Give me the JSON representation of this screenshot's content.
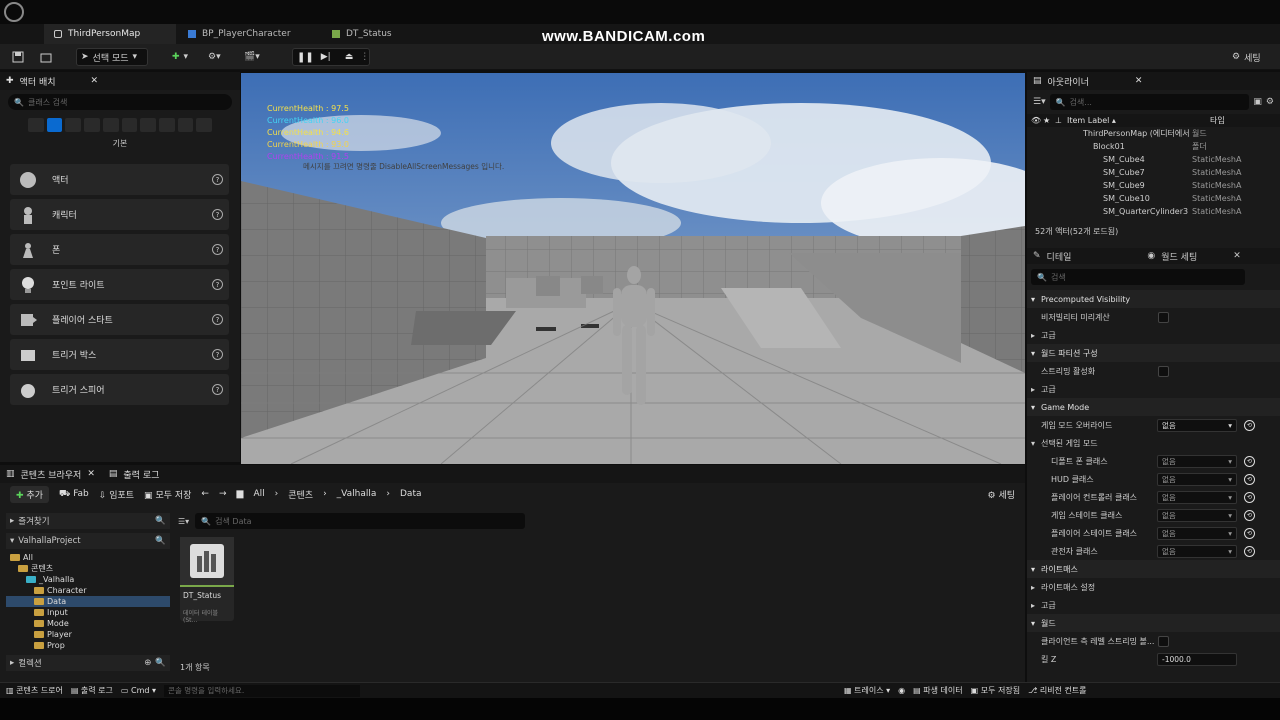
{
  "watermark": "www.BANDICAM.com",
  "tabs": [
    {
      "label": "ThirdPersonMap"
    },
    {
      "label": "BP_PlayerCharacter"
    },
    {
      "label": "DT_Status"
    }
  ],
  "toolbar": {
    "mode": "선택 모드",
    "settings": "세팅"
  },
  "place_actors": {
    "title": "액터 배치",
    "search_placeholder": "클래스 검색",
    "category": "기본",
    "items": [
      {
        "label": "액터"
      },
      {
        "label": "캐릭터"
      },
      {
        "label": "폰"
      },
      {
        "label": "포인트 라이트"
      },
      {
        "label": "플레이어 스타트"
      },
      {
        "label": "트리거 박스"
      },
      {
        "label": "트리거 스피어"
      }
    ]
  },
  "viewport": {
    "health": [
      {
        "text": "CurrentHealth : 97.5",
        "color": "#f4e04a"
      },
      {
        "text": "CurrentHealth : 96.0",
        "color": "#44d4f4"
      },
      {
        "text": "CurrentHealth : 94.6",
        "color": "#f4e04a"
      },
      {
        "text": "CurrentHealth : 93.0",
        "color": "#f4d44a"
      },
      {
        "text": "CurrentHealth : 91.5",
        "color": "#b040f0"
      }
    ],
    "message": "메시지를 끄려면 명령줄 DisableAllScreenMessages 입니다."
  },
  "outliner": {
    "title": "아웃라이너",
    "search_placeholder": "검색...",
    "col_label": "Item Label ▴",
    "col_type": "타입",
    "rows": [
      {
        "label": "ThirdPersonMap (에디터에서",
        "type": "월드",
        "indent": 0
      },
      {
        "label": "Block01",
        "type": "폴더",
        "indent": 1
      },
      {
        "label": "SM_Cube4",
        "type": "StaticMeshA",
        "indent": 2
      },
      {
        "label": "SM_Cube7",
        "type": "StaticMeshA",
        "indent": 2
      },
      {
        "label": "SM_Cube9",
        "type": "StaticMeshA",
        "indent": 2
      },
      {
        "label": "SM_Cube10",
        "type": "StaticMeshA",
        "indent": 2
      },
      {
        "label": "SM_QuarterCylinder3",
        "type": "StaticMeshA",
        "indent": 2
      }
    ],
    "count": "52개 액터(52개 로드됨)"
  },
  "details": {
    "tab_details": "디테일",
    "tab_world": "월드 세팅",
    "search_placeholder": "검색",
    "rows": [
      {
        "kind": "section",
        "label": "Precomputed Visibility"
      },
      {
        "kind": "check",
        "label": "비저빌리티 미리계산"
      },
      {
        "kind": "collapsed",
        "label": "고급"
      },
      {
        "kind": "section",
        "label": "월드 파티션 구성"
      },
      {
        "kind": "check",
        "label": "스트리밍 활성화"
      },
      {
        "kind": "collapsed",
        "label": "고급"
      },
      {
        "kind": "section",
        "label": "Game Mode"
      },
      {
        "kind": "dropdown",
        "label": "게임 모드 오버라이드",
        "value": "없음"
      },
      {
        "kind": "sub",
        "label": "선택된 게임 모드"
      },
      {
        "kind": "dropdown-dim",
        "label": "디폴트 폰 클래스",
        "value": "없음"
      },
      {
        "kind": "dropdown-dim",
        "label": "HUD 클래스",
        "value": "없음"
      },
      {
        "kind": "dropdown-dim",
        "label": "플레이어 컨트롤러 클래스",
        "value": "없음"
      },
      {
        "kind": "dropdown-dim",
        "label": "게임 스테이트 클래스",
        "value": "없음"
      },
      {
        "kind": "dropdown-dim",
        "label": "플레이어 스테이트 클래스",
        "value": "없음"
      },
      {
        "kind": "dropdown-dim",
        "label": "관전자 클래스",
        "value": "없음"
      },
      {
        "kind": "section",
        "label": "라이트매스"
      },
      {
        "kind": "collapsed",
        "label": "라이트매스 설정"
      },
      {
        "kind": "collapsed",
        "label": "고급"
      },
      {
        "kind": "section",
        "label": "월드"
      },
      {
        "kind": "check",
        "label": "클라이언트 측 레벨 스트리밍 볼..."
      },
      {
        "kind": "value",
        "label": "킬 Z",
        "value": "-1000.0"
      }
    ]
  },
  "content_browser": {
    "tab": "콘텐츠 브라우저",
    "log_tab": "출력 로그",
    "add": "추가",
    "fab": "Fab",
    "import": "임포트",
    "save_all": "모두 저장",
    "breadcrumb": [
      "All",
      "콘텐츠",
      "_Valhalla",
      "Data"
    ],
    "settings": "세팅",
    "favorites": "즐겨찾기",
    "project": "ValhallaProject",
    "tree": [
      {
        "label": "All",
        "indent": 0
      },
      {
        "label": "콘텐츠",
        "indent": 1
      },
      {
        "label": "_Valhalla",
        "indent": 2
      },
      {
        "label": "Character",
        "indent": 3
      },
      {
        "label": "Data",
        "indent": 3
      },
      {
        "label": "Input",
        "indent": 3
      },
      {
        "label": "Mode",
        "indent": 3
      },
      {
        "label": "Player",
        "indent": 3
      },
      {
        "label": "Prop",
        "indent": 3
      }
    ],
    "collections": "컬렉션",
    "search_placeholder": "검색 Data",
    "asset": {
      "name": "DT_Status",
      "type": "데이터 테이블 (St..."
    },
    "count": "1개 항목"
  },
  "statusbar": {
    "content_drawer": "콘텐츠 드로어",
    "output_log": "출력 로그",
    "cmd": "Cmd",
    "cmd_placeholder": "콘솔 명령을 입력하세요.",
    "trace": "트레이스",
    "derived": "파생 데이터",
    "save_all": "모두 저장됨",
    "revision": "리비전 컨트롤"
  }
}
